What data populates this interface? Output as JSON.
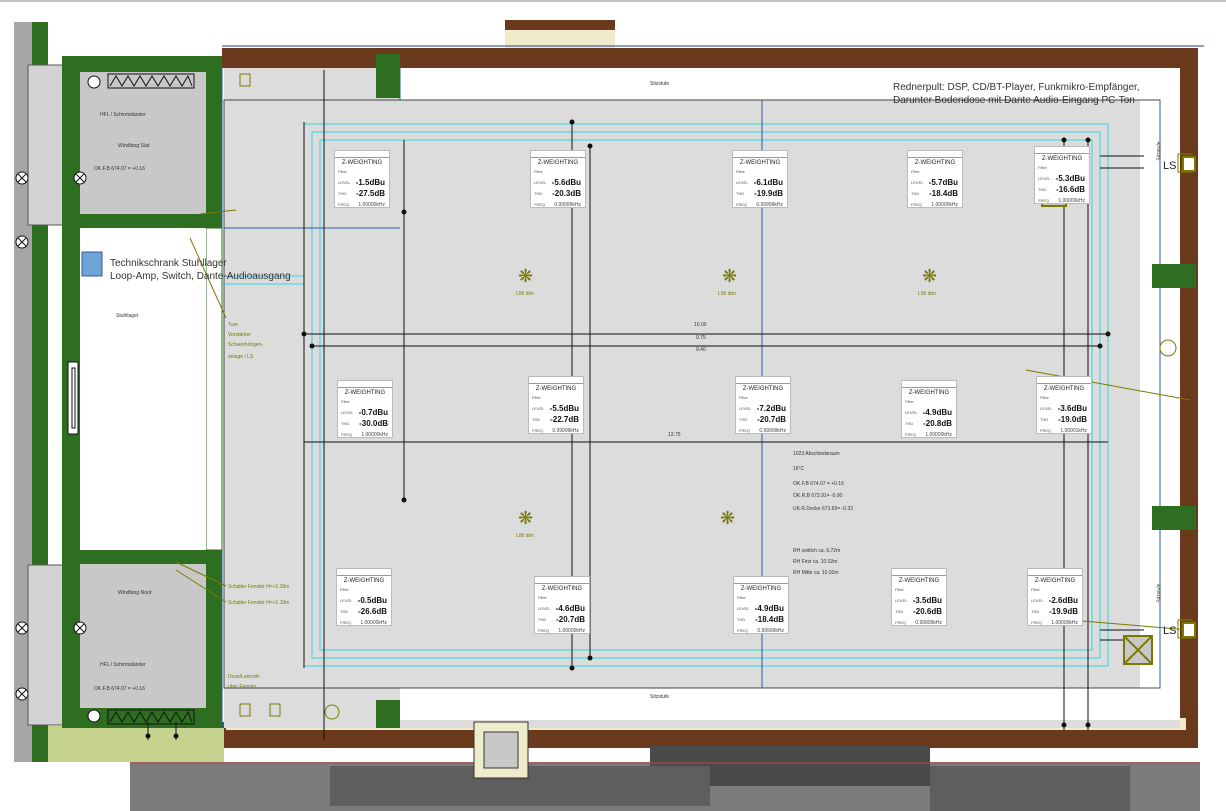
{
  "notes": {
    "rednerpult_line1": "Rednerpult: DSP, CD/BT-Player, Funkmikro-Empfänger,",
    "rednerpult_line2": "Darunter Bodendose mit Dante Audio-Eingang PC-Ton",
    "technik_line1": "Technikschrank Stuhllager",
    "technik_line2": "Loop-Amp, Switch, Dante-Audioausgang"
  },
  "rooms": {
    "windfang_sued": "Windfang Süd",
    "windfang_nord": "Windfang Nord",
    "stuhllager": "Stuhllager",
    "sitzstufe_top": "Sitzstufe",
    "sitzstufe_bottom": "Sitzstufe",
    "sitzstufe_right_top": "Sitzstufe",
    "sitzstufe_right_bottom": "Sitzstufe"
  },
  "room_info": {
    "name": "1023 Abschiedsraum",
    "temp": "16°C",
    "ok_fb": "OK.F.B 674.07 = +0.16",
    "ok_rb": "OK.R.B 673.91= -0.00",
    "uk_rd": "UK.R.Decke 673.69= -0.33",
    "rh_seitlich": "RH seitlich ca. 6.72m",
    "rh_first": "RH First ca. 10.02m",
    "rh_mitte": "RH Mitte ca. 10.02m"
  },
  "small_labels": {
    "hfl_top": "HFL / Schirmständer",
    "hfl_bottom": "HFL / Schirmständer",
    "okfb_top": "OK.F.B 674.07 = +0.16",
    "okfb_bottom": "OK.F.B 674.07 = +0.16",
    "schalter_1": "Schalter Fenster H=+1.30m",
    "schalter_2": "Schalter Fenster H=+1.10m",
    "dose_1": "Dose/Leerrohr",
    "dose_2": "über Fenster",
    "tuer_1": "Tuer",
    "tuer_2": "Verstärker",
    "tuer_3": "Schwerhörigen-",
    "tuer_4": "anlage / LS",
    "dim_1000": "10.00",
    "dim_875": "9.75",
    "dim_840": "9.40",
    "dim_1375": "13.75"
  },
  "speakers": {
    "ls_top": "LS",
    "ls_bottom": "LS"
  },
  "light_label": "L06 dim",
  "meter_common": {
    "header": "Z-WEIGHTING",
    "row1": "Filter",
    "row2": "LEVEL",
    "row3": "THD",
    "row4": "FREQ"
  },
  "meters": [
    {
      "level": "-1.5dBu",
      "thd": "-27.5dB",
      "freq": "1.00000kHz"
    },
    {
      "level": "-5.6dBu",
      "thd": "-20.3dB",
      "freq": "0.99999kHz"
    },
    {
      "level": "-6.1dBu",
      "thd": "-19.9dB",
      "freq": "0.99999kHz"
    },
    {
      "level": "-5.7dBu",
      "thd": "-18.4dB",
      "freq": "1.00000kHz"
    },
    {
      "level": "-5.3dBu",
      "thd": "-16.6dB",
      "freq": "1.00000kHz"
    },
    {
      "level": "-0.7dBu",
      "thd": "-30.0dB",
      "freq": "1.00000kHz"
    },
    {
      "level": "-5.5dBu",
      "thd": "-22.7dB",
      "freq": "0.99999kHz"
    },
    {
      "level": "-7.2dBu",
      "thd": "-20.7dB",
      "freq": "0.99999kHz"
    },
    {
      "level": "-4.9dBu",
      "thd": "-20.8dB",
      "freq": "1.00000kHz"
    },
    {
      "level": "-3.6dBu",
      "thd": "-19.0dB",
      "freq": "1.00001kHz"
    },
    {
      "level": "-0.5dBu",
      "thd": "-26.6dB",
      "freq": "1.00000kHz"
    },
    {
      "level": "-4.6dBu",
      "thd": "-20.7dB",
      "freq": "1.00000kHz"
    },
    {
      "level": "-4.9dBu",
      "thd": "-18.4dB",
      "freq": "0.99999kHz"
    },
    {
      "level": "-3.5dBu",
      "thd": "-20.6dB",
      "freq": "0.99999kHz"
    },
    {
      "level": "-2.6dBu",
      "thd": "-19.9dB",
      "freq": "1.00000kHz"
    }
  ]
}
